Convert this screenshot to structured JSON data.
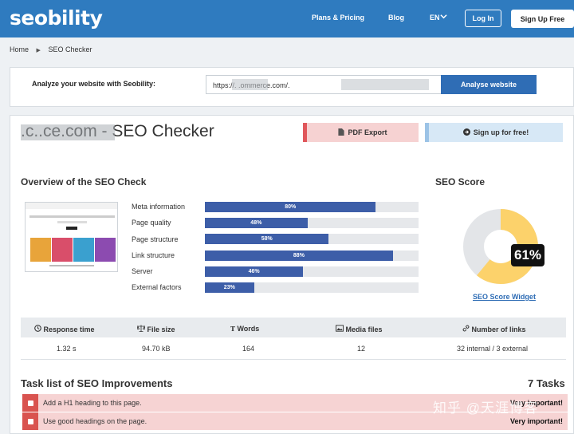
{
  "header": {
    "logo": "seobility",
    "nav": {
      "plans": "Plans & Pricing",
      "blog": "Blog",
      "lang": "EN"
    },
    "login": "Log In",
    "signup": "Sign Up Free"
  },
  "breadcrumb": {
    "home": "Home",
    "current": "SEO Checker"
  },
  "analyze": {
    "label": "Analyze your website with Seobility:",
    "url_value": "https://.      .ommerce.com/.",
    "button": "Analyse website"
  },
  "result": {
    "title": ".c..ce.com - SEO Checker",
    "pdf_button": "PDF Export",
    "free_button": "Sign up for free!"
  },
  "overview": {
    "heading": "Overview of the SEO Check",
    "metrics": [
      {
        "label": "Meta information",
        "value": 80,
        "text": "80%"
      },
      {
        "label": "Page quality",
        "value": 48,
        "text": "48%"
      },
      {
        "label": "Page structure",
        "value": 58,
        "text": "58%"
      },
      {
        "label": "Link structure",
        "value": 88,
        "text": "88%"
      },
      {
        "label": "Server",
        "value": 46,
        "text": "46%"
      },
      {
        "label": "External factors",
        "value": 23,
        "text": "23%"
      }
    ]
  },
  "score": {
    "heading": "SEO Score",
    "value": 61,
    "text": "61%",
    "link": "SEO Score Widget",
    "colors": {
      "filled": "#fcd26b",
      "empty": "#e3e5e8"
    }
  },
  "stats": {
    "headers": [
      "Response time",
      "File size",
      "Words",
      "Media files",
      "Number of links"
    ],
    "values": [
      "1.32 s",
      "94.70 kB",
      "164",
      "12",
      "32 internal / 3 external"
    ]
  },
  "tasks": {
    "heading": "Task list of SEO Improvements",
    "count": "7 Tasks",
    "items": [
      {
        "text": "Add a H1 heading to this page.",
        "importance": "Very important!"
      },
      {
        "text": "Use good headings on the page.",
        "importance": "Very important!"
      }
    ]
  },
  "watermark": "知乎 @天涯博客",
  "colors": {
    "brand": "#2f7bbf",
    "bar": "#3d5ea8",
    "task_bg": "#f6d3d3",
    "task_check": "#d9534f"
  }
}
